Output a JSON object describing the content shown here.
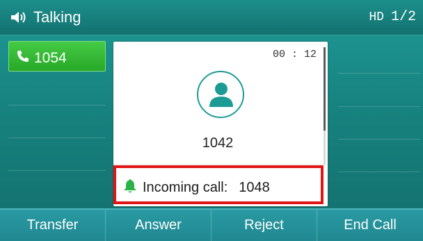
{
  "status_bar": {
    "title": "Talking",
    "hd_label": "HD",
    "page": "1/2"
  },
  "line_keys": [
    {
      "label": "1054",
      "icon": "phone-handset-icon",
      "active": true
    }
  ],
  "call": {
    "timer": "00 : 12",
    "caller_number": "1042",
    "avatar_icon": "contact-avatar-icon"
  },
  "incoming": {
    "label": "Incoming call:",
    "number": "1048",
    "icon": "bell-icon",
    "highlight_color": "#e01616"
  },
  "softkeys": [
    "Transfer",
    "Answer",
    "Reject",
    "End Call"
  ],
  "colors": {
    "background_teal": "#17827f",
    "active_line_green": "#28a828",
    "accent_teal": "#1c9a94"
  }
}
